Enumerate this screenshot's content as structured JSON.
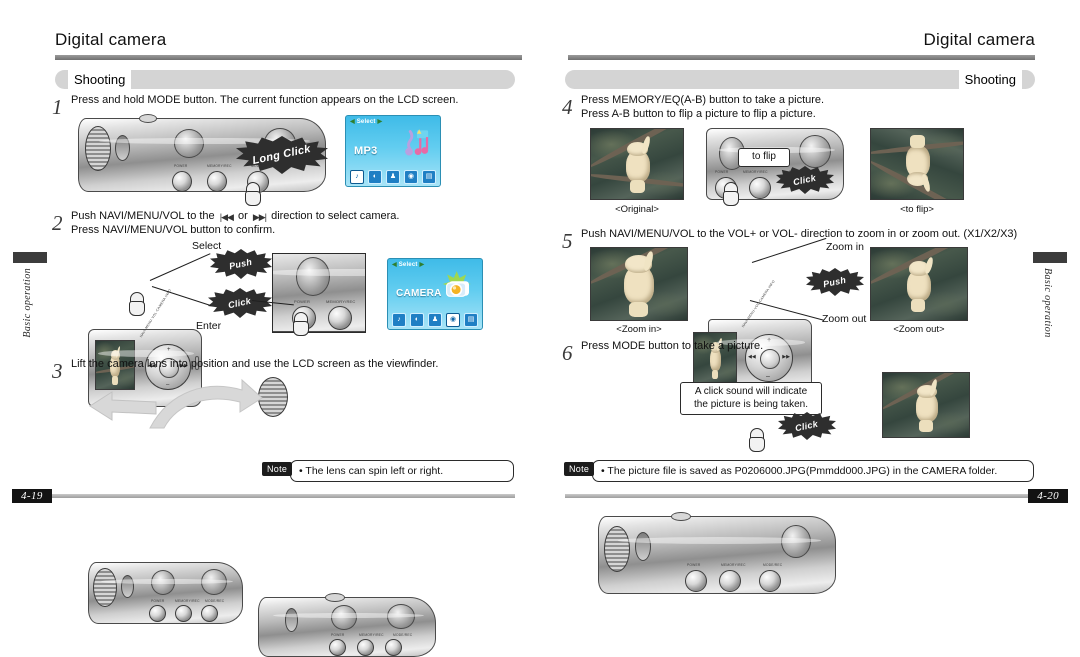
{
  "left_page": {
    "header_title": "Digital camera",
    "section_label": "Shooting",
    "page_number": "4-19",
    "side_tab": "Basic operation",
    "steps": [
      {
        "number": "1",
        "lines": [
          "Press and hold MODE button. The current function appears on the LCD screen."
        ],
        "callouts": [
          "Long Click"
        ],
        "lcd": {
          "top_label": "Select",
          "mode": "MP3",
          "icons": [
            "music-note",
            "radio",
            "voice-recorder",
            "camera",
            "text-viewer"
          ],
          "selected_icon_index": 0
        }
      },
      {
        "number": "2",
        "lines": [
          "Push NAVI/MENU/VOL to the ⏮ or ⏭ direction to select camera.",
          "Press NAVI/MENU/VOL button to confirm."
        ],
        "labels": [
          "Select",
          "Enter"
        ],
        "callouts": [
          "Push",
          "Click"
        ],
        "lcd": {
          "top_label": "Select",
          "mode": "CAMERA",
          "icons": [
            "music-note",
            "radio",
            "voice-recorder",
            "camera",
            "text-viewer"
          ],
          "selected_icon_index": 3
        }
      },
      {
        "number": "3",
        "lines": [
          "Lift the camera lens into position and use the LCD screen as the viewfinder."
        ],
        "note": {
          "tag": "Note",
          "text": "• The lens can spin left or right."
        }
      }
    ],
    "device_labels": [
      "POWER",
      "MEMORY/REC",
      "MODE/REC"
    ]
  },
  "right_page": {
    "header_title": "Digital camera",
    "section_label": "Shooting",
    "page_number": "4-20",
    "side_tab": "Basic operation",
    "steps": [
      {
        "number": "4",
        "lines": [
          "Press MEMORY/EQ(A-B) button to take a picture.",
          "Press A-B button to flip a picture to flip a picture."
        ],
        "captions": [
          "<Original>",
          "<to flip>"
        ],
        "labels": [
          "to flip"
        ],
        "callouts": [
          "Click"
        ]
      },
      {
        "number": "5",
        "lines": [
          "Push NAVI/MENU/VOL to the VOL+ or VOL- direction to zoom in or zoom out. (X1/X2/X3)"
        ],
        "captions": [
          "<Zoom in>",
          "<Zoom out>"
        ],
        "labels": [
          "Zoom in",
          "Zoom out"
        ],
        "callouts": [
          "Push"
        ]
      },
      {
        "number": "6",
        "lines": [
          "Press MODE button to  take a picture."
        ],
        "bubble": "A click sound will indicate\nthe picture is being taken.",
        "callouts": [
          "Click"
        ],
        "note": {
          "tag": "Note",
          "text": "• The picture file is saved as P0206000.JPG(Pmmdd000.JPG) in the CAMERA folder."
        }
      }
    ],
    "device_labels": [
      "POWER",
      "MEMORY/REC",
      "MODE/REC"
    ]
  },
  "colors": {
    "rule": "#8a8a8a",
    "section_bar": "#d4d4d4",
    "note_tag": "#1c1c1c",
    "lcd_blue": "#4fc3ea",
    "page_tag": "#131313"
  }
}
